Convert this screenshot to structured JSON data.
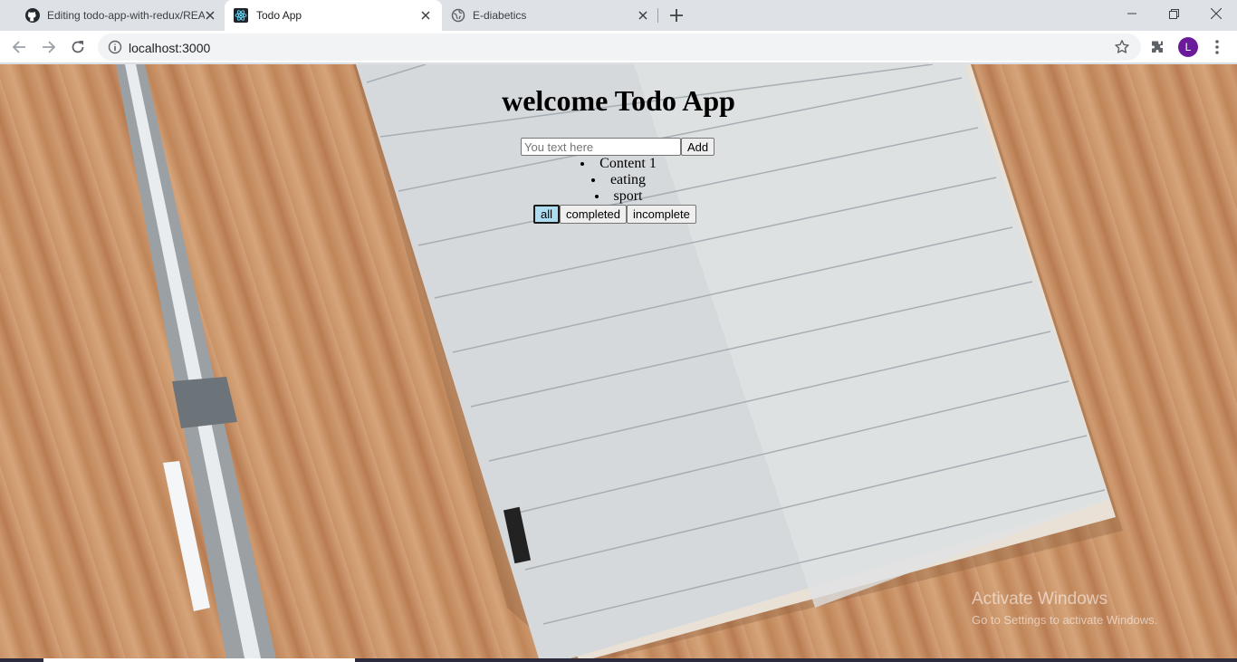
{
  "browser": {
    "tabs": [
      {
        "title": "Editing todo-app-with-redux/README",
        "icon": "github-icon",
        "active": false
      },
      {
        "title": "Todo App",
        "icon": "react-icon",
        "active": true
      },
      {
        "title": "E-diabetics",
        "icon": "globe-icon",
        "active": false
      }
    ],
    "url": "localhost:3000",
    "profile_initial": "L",
    "profile_color": "#6a1b9a"
  },
  "page": {
    "heading": "welcome Todo App",
    "input_placeholder": "You text here",
    "input_value": "",
    "add_label": "Add",
    "todos": [
      "Content 1",
      "eating",
      "sport"
    ],
    "filters": [
      {
        "label": "all",
        "active": true
      },
      {
        "label": "completed",
        "active": false
      },
      {
        "label": "incomplete",
        "active": false
      }
    ],
    "active_filter_color": "#aedcf0"
  },
  "watermark": {
    "line1": "Activate Windows",
    "line2": "Go to Settings to activate Windows."
  }
}
